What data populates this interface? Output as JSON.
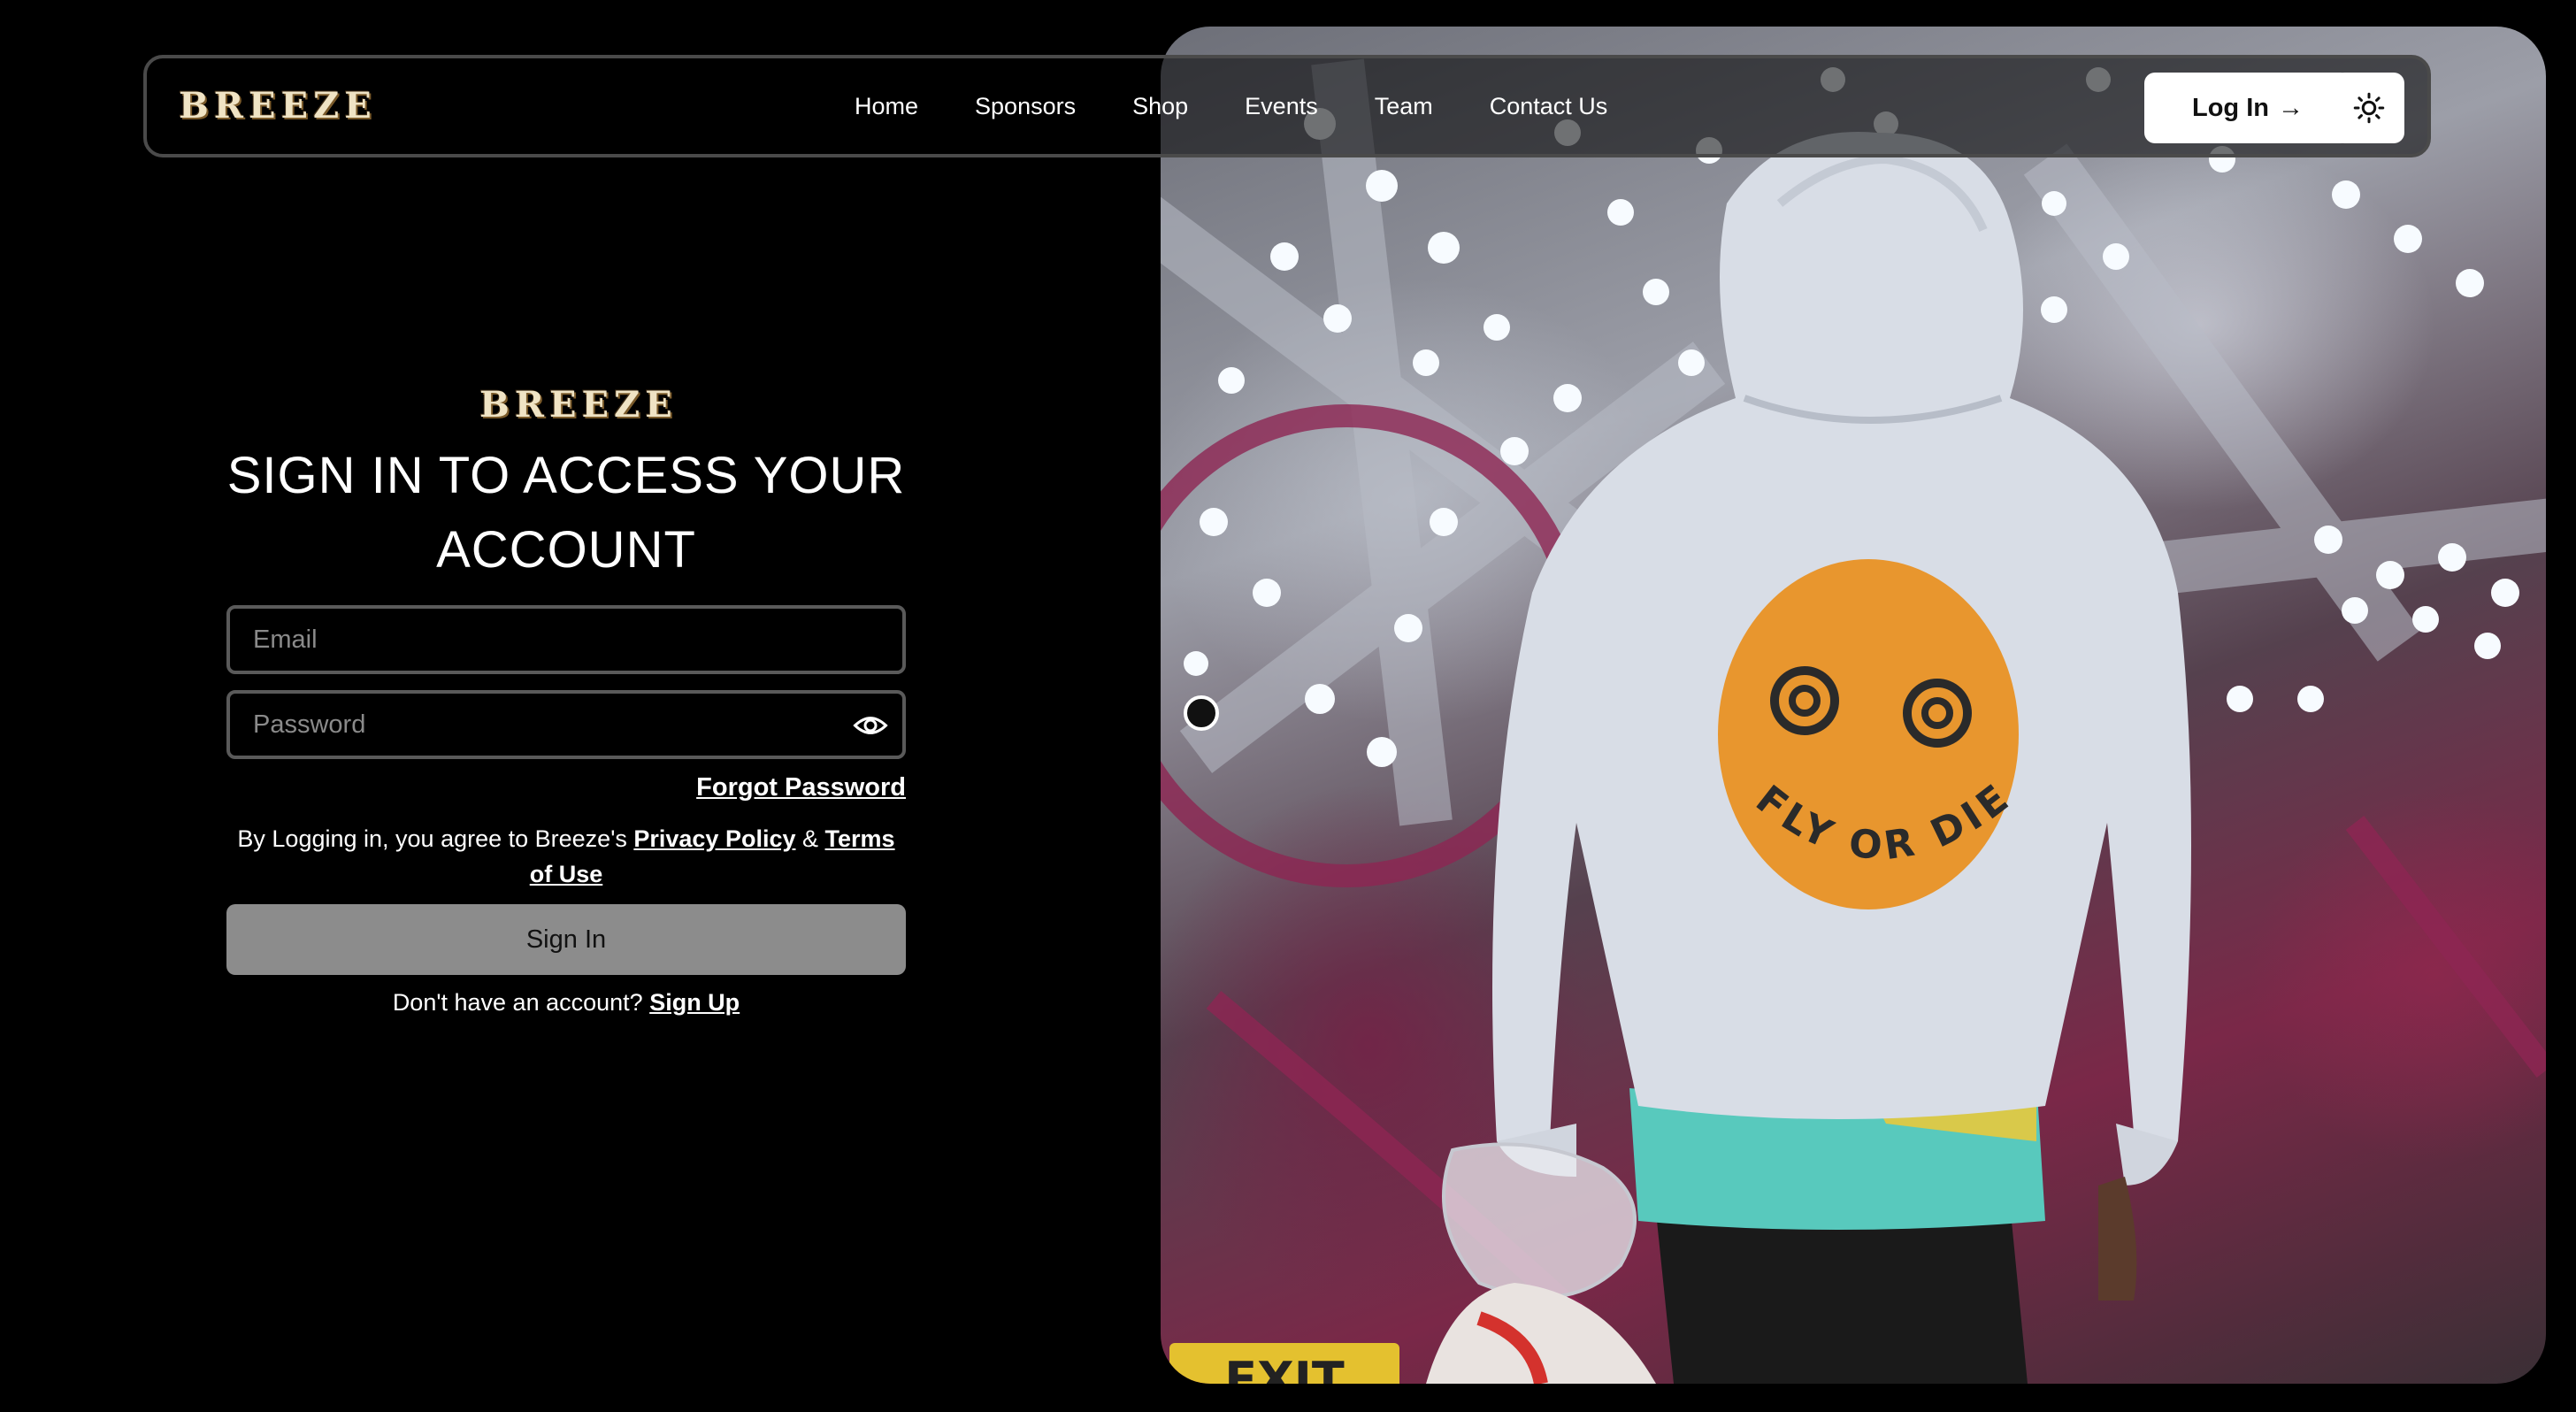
{
  "brand": {
    "name": "BREEZE"
  },
  "nav": {
    "links": [
      "Home",
      "Sponsors",
      "Shop",
      "Events",
      "Team",
      "Contact Us"
    ],
    "login_label": "Log In",
    "login_arrow": "→",
    "theme_icon": "sun-icon"
  },
  "signin": {
    "heading": "SIGN IN TO ACCESS YOUR ACCOUNT",
    "email_placeholder": "Email",
    "password_placeholder": "Password",
    "password_toggle_icon": "eye-icon",
    "forgot_password": "Forgot Password",
    "terms_prefix": "By Logging in, you agree to Breeze's",
    "privacy_policy": "Privacy Policy",
    "terms_joiner": "&",
    "terms_of_use": "Terms of Use",
    "submit_label": "Sign In",
    "no_account_text": "Don't have an account?",
    "signup_label": "Sign Up"
  },
  "hero": {
    "shirt_text": "FLY OR DIE",
    "sign_text": "EXIT"
  },
  "colors": {
    "background": "#000000",
    "button_white": "#ffffff",
    "signin_button": "#8c8c8c",
    "input_border": "#5a5a5a",
    "smiley_orange": "#e8962e"
  }
}
